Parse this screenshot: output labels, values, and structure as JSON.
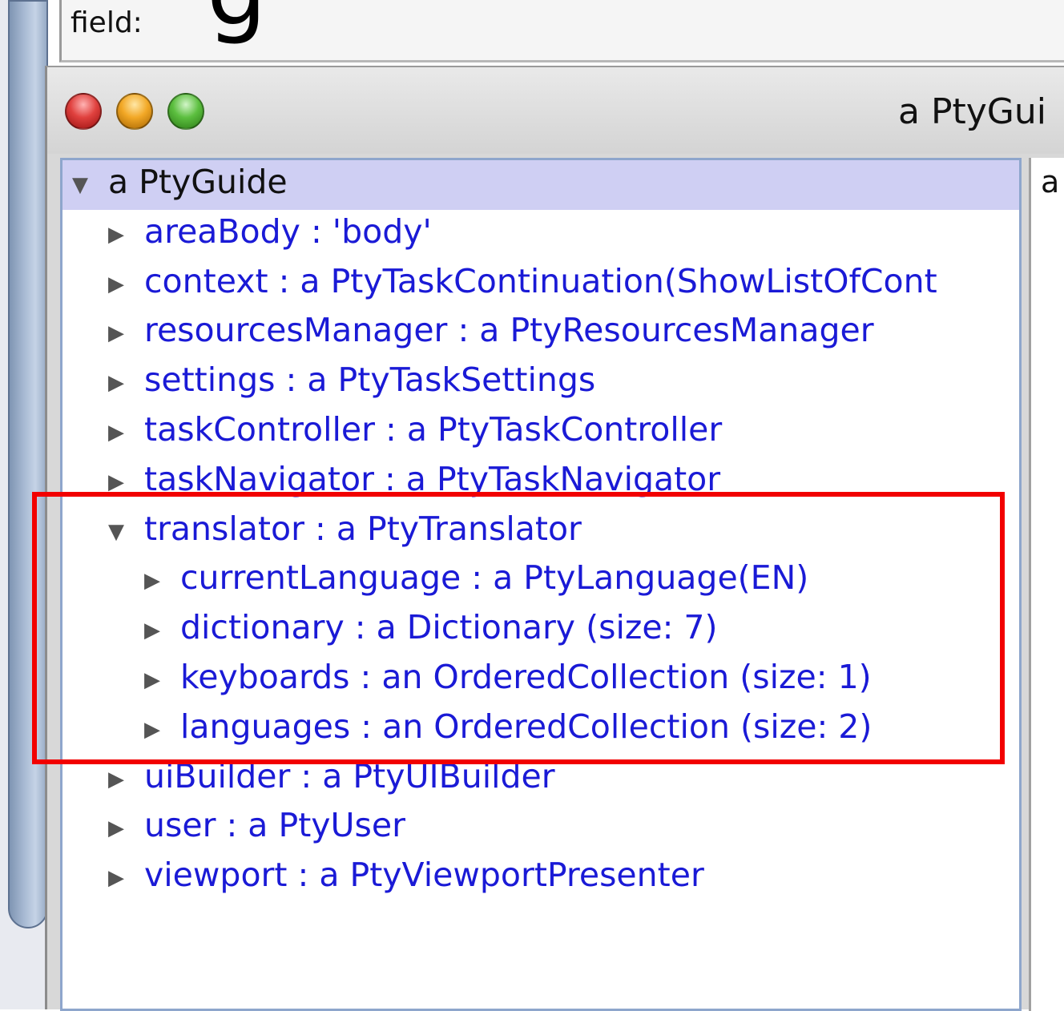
{
  "background": {
    "big_glyph": "g",
    "field_label": "field:"
  },
  "window": {
    "title": "a PtyGui",
    "right_panel_text": "a"
  },
  "tree": {
    "root": "a PtyGuide",
    "items": [
      {
        "label": "areaBody : 'body'",
        "expanded": false
      },
      {
        "label": "context : a PtyTaskContinuation(ShowListOfCont",
        "expanded": false
      },
      {
        "label": "resourcesManager : a PtyResourcesManager",
        "expanded": false
      },
      {
        "label": "settings : a PtyTaskSettings",
        "expanded": false
      },
      {
        "label": "taskController : a PtyTaskController",
        "expanded": false
      },
      {
        "label": "taskNavigator : a PtyTaskNavigator",
        "expanded": false
      },
      {
        "label": "translator : a PtyTranslator",
        "expanded": true
      },
      {
        "label": "currentLanguage : a PtyLanguage(EN)",
        "expanded": false
      },
      {
        "label": "dictionary : a Dictionary  (size: 7)",
        "expanded": false
      },
      {
        "label": "keyboards : an OrderedCollection  (size: 1)",
        "expanded": false
      },
      {
        "label": "languages : an OrderedCollection  (size: 2)",
        "expanded": false
      },
      {
        "label": "uiBuilder : a PtyUIBuilder",
        "expanded": false
      },
      {
        "label": "user : a PtyUser",
        "expanded": false
      },
      {
        "label": "viewport : a PtyViewportPresenter",
        "expanded": false
      }
    ],
    "arrow_collapsed": "▶",
    "arrow_expanded": "▼"
  },
  "colors": {
    "selection": "#cfcff3",
    "item_text": "#1a1ad6",
    "highlight": "#f20000"
  }
}
